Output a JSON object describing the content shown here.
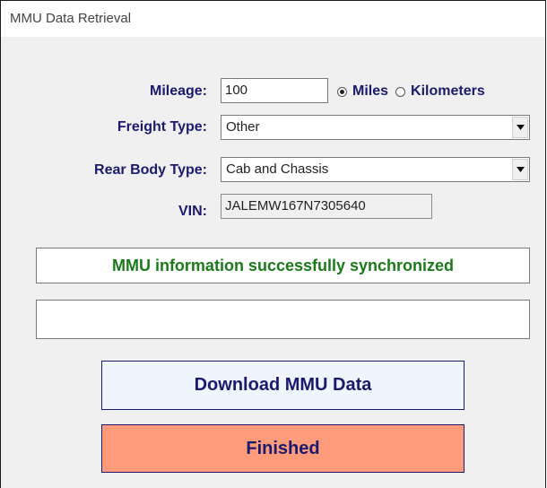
{
  "window": {
    "title": "MMU Data Retrieval"
  },
  "form": {
    "mileage_label": "Mileage:",
    "mileage_value": "100",
    "units": [
      {
        "label": "Miles",
        "checked": true
      },
      {
        "label": "Kilometers",
        "checked": false
      }
    ],
    "freight_label": "Freight Type:",
    "freight_value": "Other",
    "rear_body_label": "Rear Body Type:",
    "rear_body_value": "Cab and Chassis",
    "vin_label": "VIN:",
    "vin_value": "JALEMW167N7305640"
  },
  "status": {
    "message": "MMU information successfully synchronized",
    "message_color": "#1a7a1a",
    "secondary_message": ""
  },
  "buttons": {
    "download_label": "Download MMU Data",
    "download_bg": "#eef5fd",
    "finished_label": "Finished",
    "finished_bg": "#fd9b7a"
  }
}
